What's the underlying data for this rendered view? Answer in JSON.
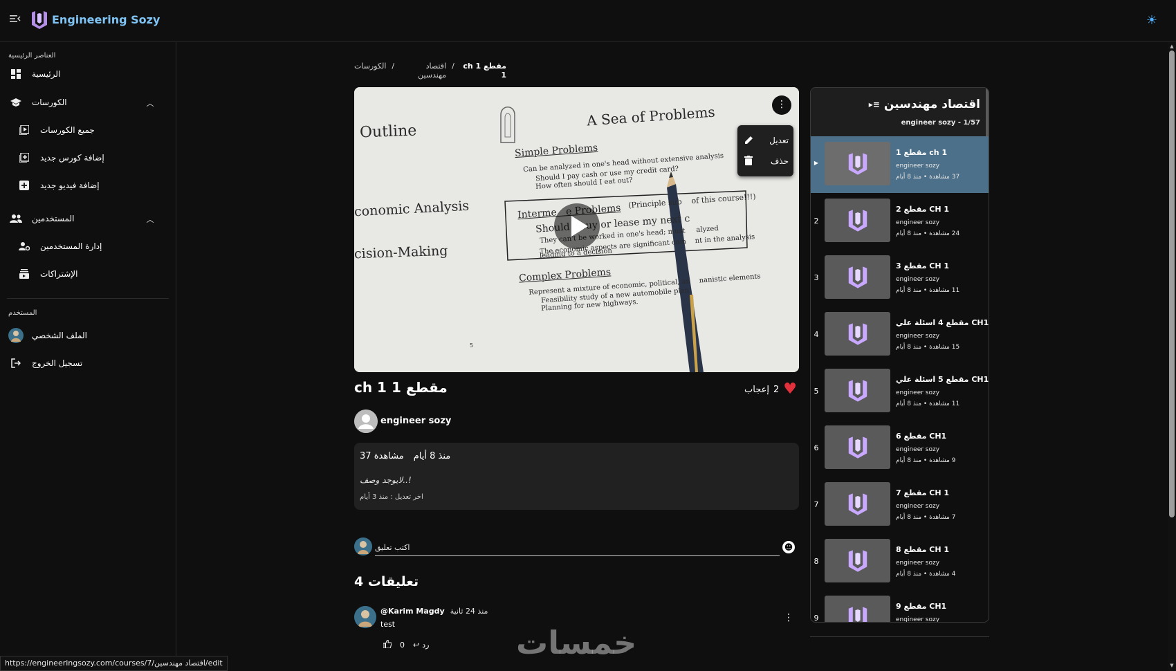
{
  "header": {
    "app_title": "Engineering Sozy",
    "menu_icon": "menu-collapse-icon",
    "theme_icon": "sun-icon"
  },
  "sidebar": {
    "section_main": "العناصر الرئيسية",
    "home": "الرئيسية",
    "courses": "الكورسات",
    "all_courses": "جميع الكورسات",
    "add_course": "إضافة كورس جديد",
    "add_video": "إضافة فيديو جديد",
    "users": "المستخدمين",
    "manage_users": "إدارة المستخدمين",
    "subscriptions": "الإشتراكات",
    "section_user": "المستخدم",
    "profile": "الملف الشخصي",
    "logout": "تسجيل الخروج"
  },
  "breadcrumb": {
    "courses": "الكورسات",
    "course": "اقتصاد مهندسين",
    "current": "مقطع 1 ch 1"
  },
  "video": {
    "title": "مقطع 1 ch 1",
    "likes_count": "2",
    "likes_label": "إعجاب",
    "menu_edit": "تعديل",
    "menu_delete": "حذف",
    "slide_headline": "A Sea of Problems",
    "slide_left_1": "Outline",
    "slide_left_2": "conomic Analysis",
    "slide_left_3": "cision-Making",
    "slide_simple": "Simple Problems",
    "slide_simple_1": "Can be analyzed in one's head without extensive analysis",
    "slide_simple_2": "Should I pay cash or use my credit card?",
    "slide_simple_3": "How often should I eat out?",
    "slide_inter": "Interme   e Problems",
    "slide_inter_note": "(Principle sub    of this course!!!)",
    "slide_inter_1": "Should I buy or lease my next c",
    "slide_inter_2": "They can't be worked in one's head; must     alyzed",
    "slide_inter_3": "The economic aspects are significant com    nt in the analysis",
    "slide_inter_4": "leading to a decision",
    "slide_complex": "Complex Problems",
    "slide_complex_1": "Represent a mixture of economic, political, an    nanistic elements",
    "slide_complex_2": "Feasibility study of a new automobile plan",
    "slide_complex_3": "Planning for new highways.",
    "slide_page": "5"
  },
  "channel": {
    "name": "engineer sozy"
  },
  "description": {
    "time": "منذ 8 أيام",
    "views": "37 مشاهدة",
    "text": "لايوجد وصف..!",
    "edited": "اخر تعديل : منذ 3 أيام"
  },
  "comments": {
    "input_placeholder": "اكتب تعليق",
    "count_label": "4 تعليقات",
    "items": [
      {
        "author": "@Karim Magdy",
        "time": "منذ 24 ثانية",
        "body": "test",
        "likes": "0",
        "reply": "رد"
      }
    ]
  },
  "playlist": {
    "title": "اقتصاد مهندسين",
    "subtitle": "engineer sozy - 1/57",
    "items": [
      {
        "index": "",
        "name": "مقطع 1 ch 1",
        "channel": "engineer sozy",
        "meta": "37 مشاهدة • منذ 8 أيام"
      },
      {
        "index": "2",
        "name": "مقطع 2 CH 1",
        "channel": "engineer sozy",
        "meta": "24 مشاهدة • منذ 8 أيام"
      },
      {
        "index": "3",
        "name": "مقطع 3 CH 1",
        "channel": "engineer sozy",
        "meta": "11 مشاهدة • منذ 8 أيام"
      },
      {
        "index": "4",
        "name": "مقطع 4 اسئلة علي CH1",
        "channel": "engineer sozy",
        "meta": "15 مشاهدة • منذ 8 أيام"
      },
      {
        "index": "5",
        "name": "مقطع 5 اسئلة علي CH1",
        "channel": "engineer sozy",
        "meta": "11 مشاهدة • منذ 8 أيام"
      },
      {
        "index": "6",
        "name": "مقطع 6 CH1",
        "channel": "engineer sozy",
        "meta": "9 مشاهدة • منذ 8 أيام"
      },
      {
        "index": "7",
        "name": "مقطع 7 CH 1",
        "channel": "engineer sozy",
        "meta": "7 مشاهدة • منذ 8 أيام"
      },
      {
        "index": "8",
        "name": "مقطع 8 CH 1",
        "channel": "engineer sozy",
        "meta": "4 مشاهدة • منذ 8 أيام"
      },
      {
        "index": "9",
        "name": "مقطع 9 CH1",
        "channel": "engineer sozy",
        "meta": ""
      }
    ]
  },
  "status_url": "https://engineeringsozy.com/courses/7/اقتصاد مهندسين/edit",
  "watermark": "خمسات",
  "colors": {
    "accent": "#7fc4f5",
    "active_item": "#4c7089",
    "like": "#e0313c",
    "logo": "#b48fe6"
  }
}
